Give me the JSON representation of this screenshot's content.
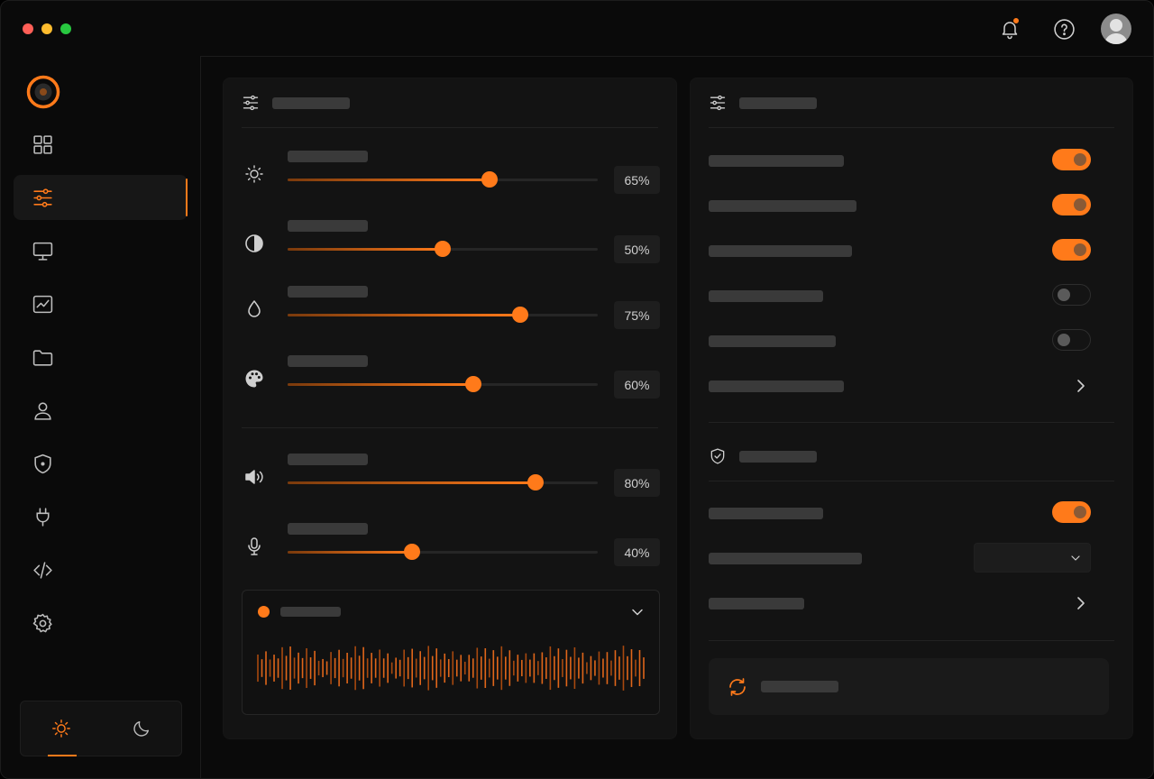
{
  "window": {
    "traffic_lights": {
      "close": "#ff5f57",
      "minimize": "#febc2e",
      "maximize": "#28c840"
    }
  },
  "topbar": {
    "icons": [
      "bell-icon",
      "help-icon",
      "user-avatar"
    ],
    "has_notification": true
  },
  "theme": {
    "accent": "#ff7a1a",
    "background": "#0a0a0a",
    "panel": "#131313",
    "placeholder": "#3a3a3a"
  },
  "sidebar": {
    "items": [
      {
        "icon": "grid-icon",
        "active": false
      },
      {
        "icon": "sliders-icon",
        "active": true
      },
      {
        "icon": "monitor-icon",
        "active": false
      },
      {
        "icon": "chart-icon",
        "active": false
      },
      {
        "icon": "folder-icon",
        "active": false
      },
      {
        "icon": "user-icon",
        "active": false
      },
      {
        "icon": "shield-icon",
        "active": false
      },
      {
        "icon": "plug-icon",
        "active": false
      },
      {
        "icon": "code-icon",
        "active": false
      },
      {
        "icon": "gear-icon",
        "active": false
      }
    ],
    "theme_toggle": {
      "options": [
        "sun-icon",
        "moon-icon"
      ],
      "selected": "sun-icon"
    }
  },
  "adjustments": {
    "header_icon": "sliders-icon",
    "sliders": [
      {
        "icon": "brightness-icon",
        "value": 65,
        "display": "65%"
      },
      {
        "icon": "contrast-icon",
        "value": 50,
        "display": "50%"
      },
      {
        "icon": "drop-icon",
        "value": 75,
        "display": "75%"
      },
      {
        "icon": "palette-icon",
        "value": 60,
        "display": "60%"
      },
      {
        "icon": "volume-icon",
        "value": 80,
        "display": "80%"
      },
      {
        "icon": "microphone-icon",
        "value": 40,
        "display": "40%"
      }
    ],
    "waveform": {
      "status_color": "#ff7a1a",
      "expanded": true
    }
  },
  "preferences": {
    "header_icon": "sliders-icon",
    "toggles": [
      {
        "on": true
      },
      {
        "on": true
      },
      {
        "on": true
      },
      {
        "on": false
      },
      {
        "on": false
      }
    ],
    "security_header_icon": "shield-check-icon",
    "security_toggle": {
      "on": true
    },
    "sync_icon": "refresh-icon"
  }
}
